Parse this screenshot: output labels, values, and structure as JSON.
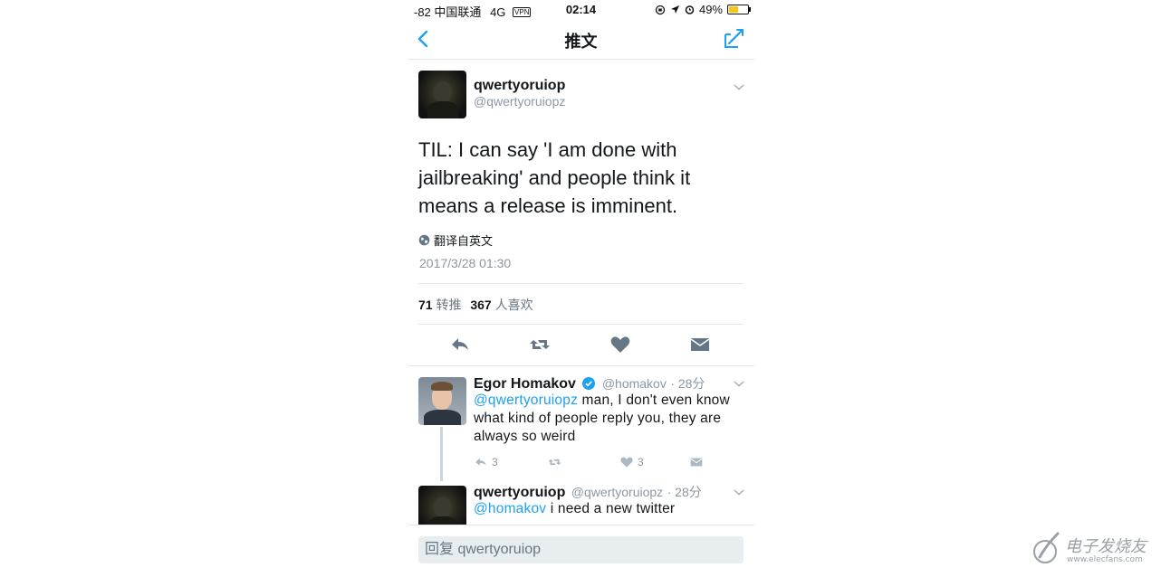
{
  "status_bar": {
    "signal": "-82",
    "carrier": "中国联通",
    "network": "4G",
    "vpn": "VPN",
    "time": "02:14",
    "battery_percent": "49%",
    "battery_level": 0.49,
    "battery_color": "#f5c518"
  },
  "nav": {
    "back_icon": "chevron-left-icon",
    "title": "推文",
    "compose_icon": "compose-icon"
  },
  "tweet": {
    "name": "qwertyoruiop",
    "handle": "@qwertyoruiopz",
    "text": "TIL: I can say 'I am done with jailbreaking' and people think it means a release is imminent.",
    "translate": "翻译自英文",
    "date": "2017/3/28 01:30",
    "retweets_count": "71",
    "retweets_label": "转推",
    "likes_count": "367",
    "likes_label": "人喜欢"
  },
  "replies": [
    {
      "name": "Egor Homakov",
      "handle": "@homakov",
      "time": "· 28分",
      "mention": "@qwertyoruiopz",
      "text": " man, I don't even know what kind of people reply you, they are always so weird",
      "reply_count": "3",
      "like_count": "3"
    },
    {
      "name": "qwertyoruiop",
      "handle": "@qwertyoruiopz",
      "time": "· 28分",
      "mention": "@homakov",
      "text": " i need a new twitter"
    }
  ],
  "reply_bar": {
    "placeholder": "回复 qwertyoruiop"
  },
  "watermark": {
    "text": "电子发烧友",
    "url": "www.elecfans.com"
  },
  "colors": {
    "accent": "#1da1f2",
    "muted": "#8899a6",
    "icon": "#657786"
  }
}
